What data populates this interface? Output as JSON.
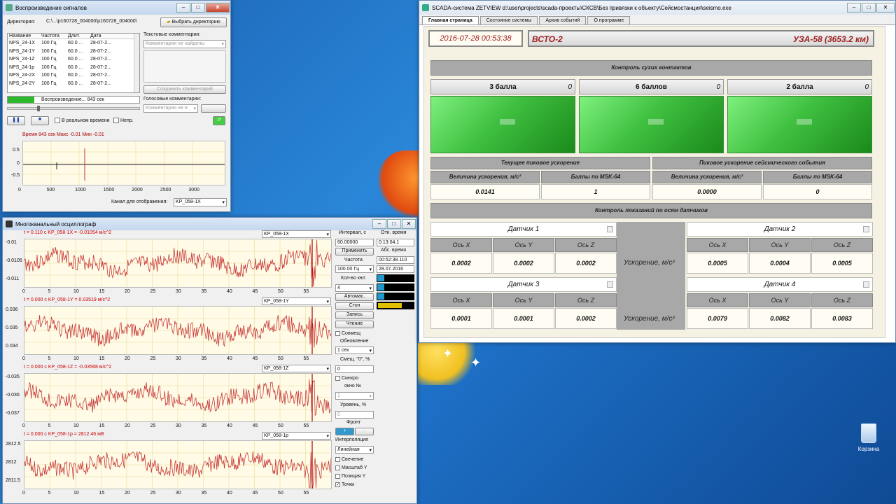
{
  "playback": {
    "title": "Воспроизведение сигналов",
    "dir_label": "Директория:",
    "dir_value": "C:\\...\\p160728_004000\\p160728_004000\\",
    "choose_dir": "Выбрать директорию",
    "columns": [
      "Название",
      "Частота",
      "Длит.",
      "Дата"
    ],
    "rows": [
      [
        "NPS_24-1X",
        "100 Гц",
        "60.0 ...",
        "28-07-2..."
      ],
      [
        "NPS_24-1Y",
        "100 Гц",
        "60.0 ...",
        "28-07-2..."
      ],
      [
        "NPS_24-1Z",
        "100 Гц",
        "60.0 ...",
        "28-07-2..."
      ],
      [
        "NPS_24-1p",
        "100 Гц",
        "60.0 ...",
        "28-07-2..."
      ],
      [
        "NPS_24-2X",
        "100 Гц",
        "60.0 ...",
        "28-07-2..."
      ],
      [
        "NPS_24-2Y",
        "100 Гц",
        "60.0 ...",
        "28-07-2..."
      ]
    ],
    "text_comments": "Текстовые комментарии:",
    "comments_none": "Комментарии не найдены",
    "save_comment": "Сохранить комментарий",
    "voice_comments": "Голосовые комментарии:",
    "voice_value": "Комментарии не н",
    "progress": "Воспроизведение... 843 сек",
    "progress_fraction": 0.2,
    "realtime": "В реальном времени",
    "continuous": "Непр.",
    "stats": "Время   843 сек  Макс   -0.01  Мин   -0.01",
    "y_ticks": [
      "0.5",
      "0",
      "-0.5"
    ],
    "x_ticks": [
      "0",
      "500",
      "1000",
      "1500",
      "2000",
      "2500",
      "3000"
    ],
    "channel_label": "Канал для отображения:",
    "channel_value": "KP_058-1X"
  },
  "osc": {
    "title": "Многоканальный осциллограф",
    "channels": [
      {
        "header": "t = 0.110 c  KP_058-1X = -0.01054 м/с^2",
        "select": "KP_058-1X",
        "yticks": [
          "-0.01",
          "-0.0105",
          "-0.011"
        ]
      },
      {
        "header": "t = 0.000 c  KP_058-1Y = 0.03519 м/с^2",
        "select": "KP_058-1Y",
        "yticks": [
          "0.036",
          "0.035",
          "0.034"
        ]
      },
      {
        "header": "t = 0.000 c  KP_058-1Z = -0.03568 м/с^2",
        "select": "KP_058-1Z",
        "yticks": [
          "-0.035",
          "-0.036",
          "-0.037"
        ]
      },
      {
        "header": "t = 0.000 c  KP_058-1p = 2812.46 мВ",
        "select": "KP_058-1p",
        "yticks": [
          "2812.5",
          "2812",
          "2811.5"
        ]
      }
    ],
    "x_ticks": [
      "0",
      "5",
      "10",
      "15",
      "20",
      "25",
      "30",
      "35",
      "40",
      "45",
      "50",
      "55"
    ],
    "interval_label": "Интервал, с",
    "interval_value": "60.00000",
    "apply": "Применить",
    "freq_label": "Частота",
    "freq_value": "100.00 Гц",
    "rel_time_label": "Отн. время",
    "rel_time_value": "0:13:04.1",
    "abs_time_label": "Абс. время",
    "abs_time_value": "00:52:38.110",
    "date_value": "28.07.2016",
    "count_label": "Кол-во кнл",
    "count_value": "4",
    "auto": "Автомас.",
    "stop": "Стоп",
    "record": "Запись",
    "read": "Чтение",
    "combine": "Совмещ",
    "update_label": "Обновление",
    "update_value": "1 сек",
    "offset_label": "Смещ. \"0\", %",
    "offset_value": "0",
    "sync": "Синхро",
    "window_label": "окно №",
    "window_value": "1",
    "level_label": "Уровень, %",
    "level_value": "0",
    "front_label": "Фронт",
    "front_plus": "+",
    "front_minus": "-",
    "interp_label": "Интерполяция",
    "interp_value": "Линейная",
    "glow": "Свечение",
    "scale_y": "Масштаб Y",
    "pos_y": "Позиция Y",
    "points": "Точки"
  },
  "scada": {
    "title": "SCADA-система ZETVIEW d:\\user\\projects\\scada-проекты\\СКСВ\\Без привязки к объекту\\Сейсмостанция\\seismo.exe",
    "tabs": [
      "Главная страница",
      "Состояние системы",
      "Архив событий",
      "О программе"
    ],
    "datetime": "2016-07-28 00:53:38",
    "station": "ВСТО-2",
    "location": "УЗА-58 (3653.2 км)",
    "dry_contacts": "Контроль сухих контактов",
    "levels": [
      {
        "label": "3 балла",
        "count": "0"
      },
      {
        "label": "6 баллов",
        "count": "0"
      },
      {
        "label": "2 балла",
        "count": "0"
      }
    ],
    "current_peak": "Текущее пиковое ускорение",
    "event_peak": "Пиковое ускорение сейсмического события",
    "accel_label": "Величина ускорения, м/с²",
    "msk_label": "Баллы по MSK-64",
    "current_accel": "0.0141",
    "current_msk": "1",
    "event_accel": "0.0000",
    "event_msk": "0",
    "axes_control": "Контроль показаний по осям датчиков",
    "accel_unit": "Ускорение, м/с²",
    "sensors": [
      {
        "name": "Датчик 1",
        "axes": [
          "Ось X",
          "Ось Y",
          "Ось Z"
        ],
        "values": [
          "0.0002",
          "0.0002",
          "0.0002"
        ]
      },
      {
        "name": "Датчик 2",
        "axes": [
          "Ось X",
          "Ось Y",
          "Ось Z"
        ],
        "values": [
          "0.0005",
          "0.0004",
          "0.0005"
        ]
      },
      {
        "name": "Датчик 3",
        "axes": [
          "Ось X",
          "Ось Y",
          "Ось Z"
        ],
        "values": [
          "0.0001",
          "0.0001",
          "0.0002"
        ]
      },
      {
        "name": "Датчик 4",
        "axes": [
          "Ось X",
          "Ось Y",
          "Ось Z"
        ],
        "values": [
          "0.0079",
          "0.0082",
          "0.0083"
        ]
      }
    ]
  },
  "desktop": {
    "recycle_bin": "Корзина"
  }
}
